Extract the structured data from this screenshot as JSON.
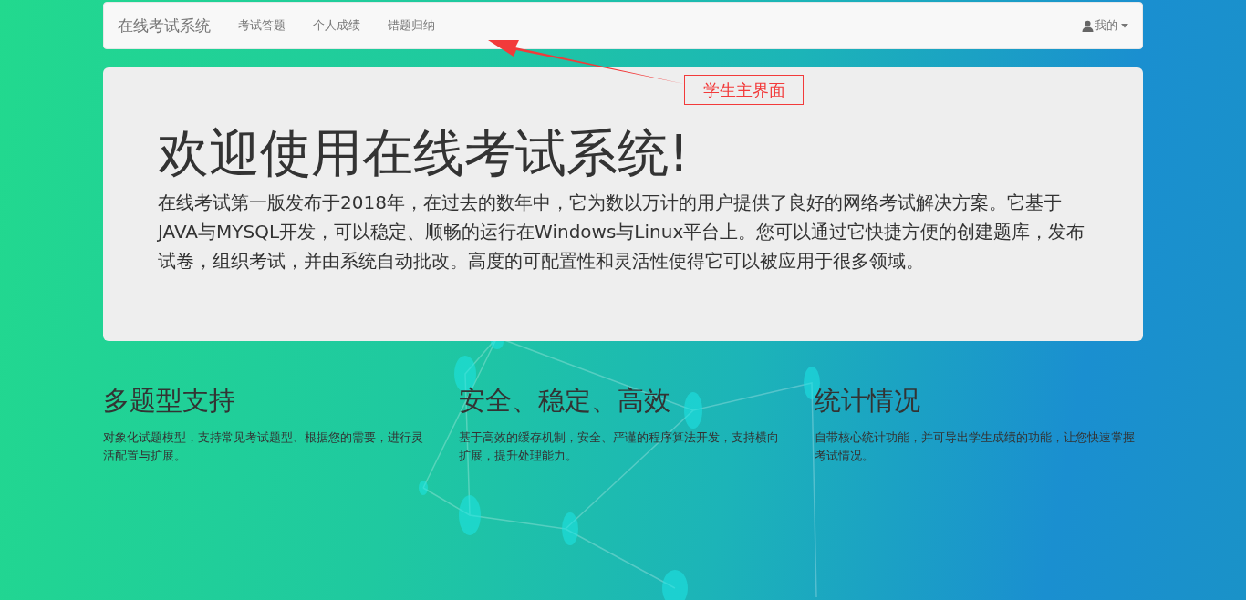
{
  "navbar": {
    "brand": "在线考试系统",
    "links": [
      {
        "label": "考试答题"
      },
      {
        "label": "个人成绩"
      },
      {
        "label": "错题归纳"
      }
    ],
    "user_menu": "我的"
  },
  "annotation": {
    "label": "学生主界面"
  },
  "jumbotron": {
    "title": "欢迎使用在线考试系统!",
    "text": "在线考试第一版发布于2018年，在过去的数年中，它为数以万计的用户提供了良好的网络考试解决方案。它基于JAVA与MYSQL开发，可以稳定、顺畅的运行在Windows与Linux平台上。您可以通过它快捷方便的创建题库，发布试卷，组织考试，并由系统自动批改。高度的可配置性和灵活性使得它可以被应用于很多领域。"
  },
  "features": [
    {
      "title": "多题型支持",
      "text": "对象化试题模型，支持常见考试题型、根据您的需要，进行灵活配置与扩展。"
    },
    {
      "title": "安全、稳定、高效",
      "text": "基于高效的缓存机制，安全、严谨的程序算法开发，支持横向扩展，提升处理能力。"
    },
    {
      "title": "统计情况",
      "text": "自带核心统计功能，并可导出学生成绩的功能，让您快速掌握考试情况。"
    }
  ]
}
